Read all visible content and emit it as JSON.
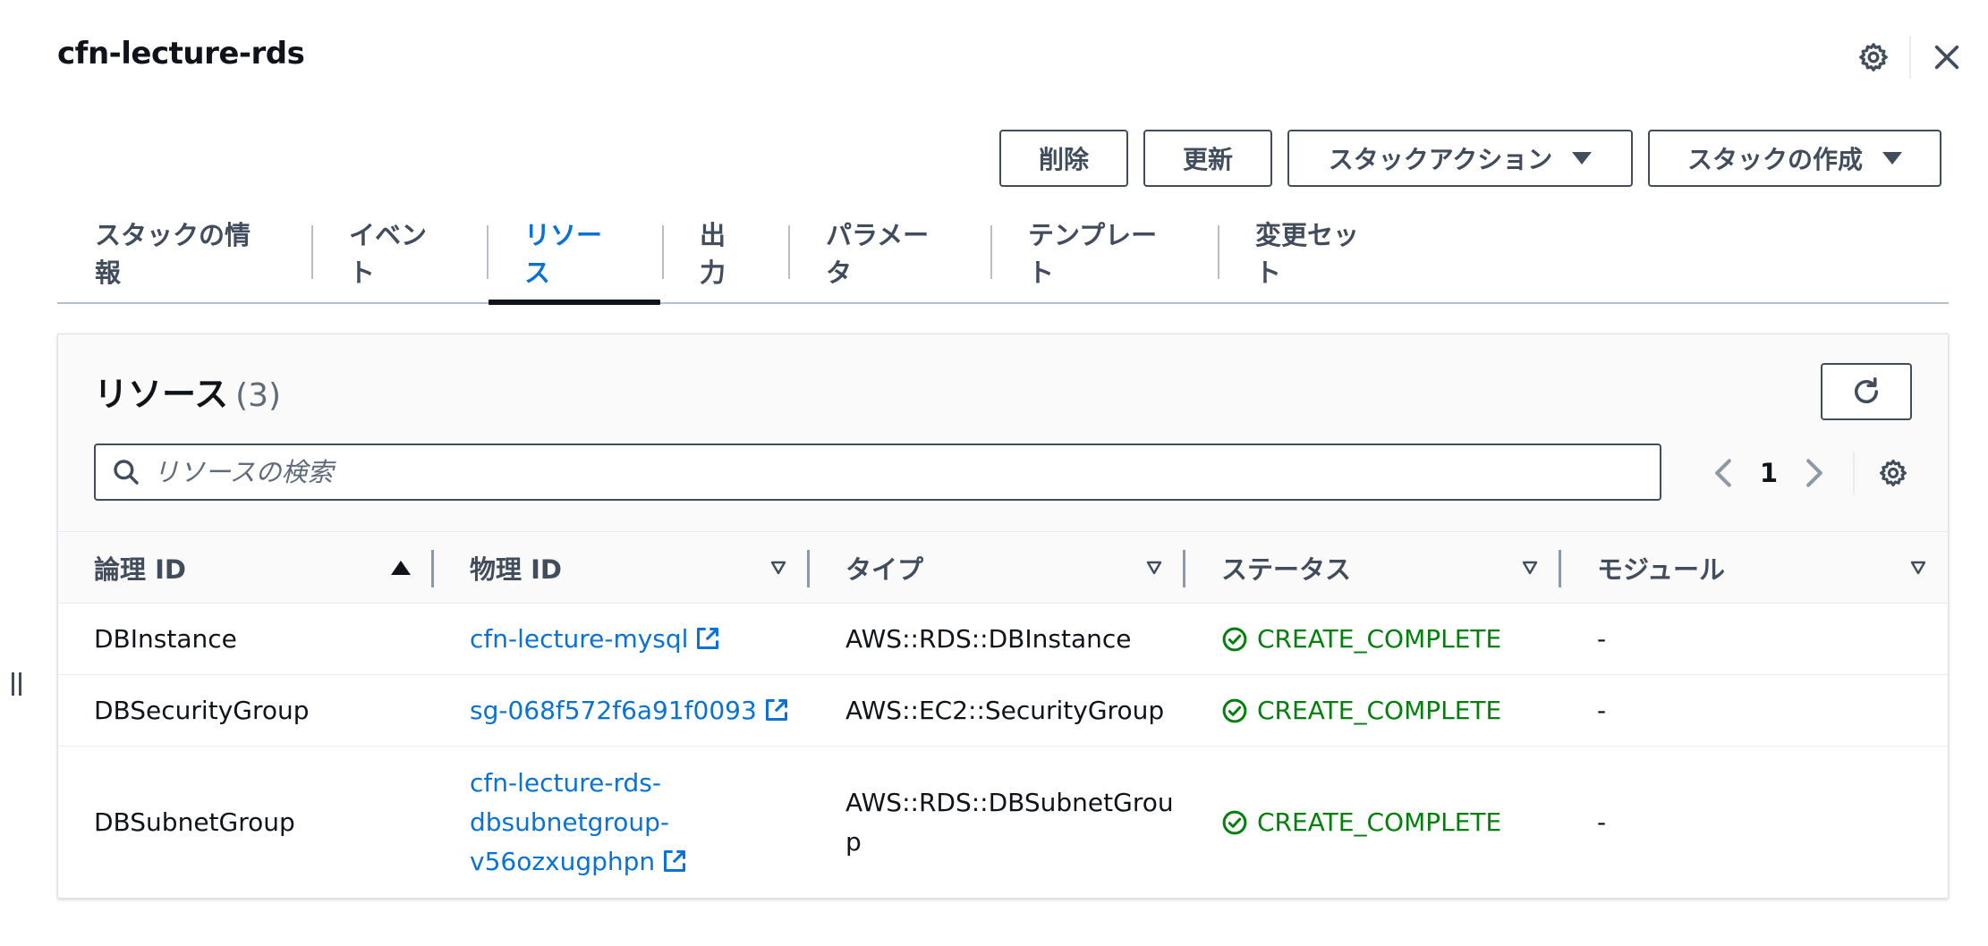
{
  "header": {
    "title": "cfn-lecture-rds"
  },
  "actions": {
    "delete": "削除",
    "update": "更新",
    "stack_actions": "スタックアクション",
    "create_stack": "スタックの作成"
  },
  "tabs": [
    {
      "label": "スタックの情報"
    },
    {
      "label": "イベント"
    },
    {
      "label": "リソース",
      "active": true
    },
    {
      "label": "出力"
    },
    {
      "label": "パラメータ"
    },
    {
      "label": "テンプレート"
    },
    {
      "label": "変更セット"
    }
  ],
  "resources": {
    "title": "リソース",
    "count": "(3)",
    "search_placeholder": "リソースの検索",
    "page": "1",
    "columns": [
      "論理 ID",
      "物理 ID",
      "タイプ",
      "ステータス",
      "モジュール"
    ],
    "sort": {
      "column": "論理 ID",
      "direction": "ascending"
    },
    "rows": [
      {
        "logical_id": "DBInstance",
        "physical_id": "cfn-lecture-mysql",
        "type": "AWS::RDS::DBInstance",
        "status": "CREATE_COMPLETE",
        "module": "-"
      },
      {
        "logical_id": "DBSecurityGroup",
        "physical_id": "sg-068f572f6a91f0093",
        "type": "AWS::EC2::SecurityGroup",
        "status": "CREATE_COMPLETE",
        "module": "-"
      },
      {
        "logical_id": "DBSubnetGroup",
        "physical_id": [
          "cfn-lecture-rds-",
          "dbsubnetgroup-",
          "v56ozxugphpn"
        ],
        "type": [
          "AWS::RDS::DBSubnetGrou",
          "p"
        ],
        "status": "CREATE_COMPLETE",
        "module": "-"
      }
    ]
  },
  "colors": {
    "link": "#0972d3",
    "success": "#037f0c",
    "text": "#0f141a",
    "secondary": "#414d5c"
  },
  "icons": [
    "settings-icon",
    "close-icon",
    "caret-down-icon",
    "refresh-icon",
    "search-icon",
    "chevron-left-icon",
    "chevron-right-icon",
    "sort-ascending-icon",
    "sort-icon",
    "external-link-icon",
    "status-success-icon",
    "drag-handle-icon"
  ]
}
